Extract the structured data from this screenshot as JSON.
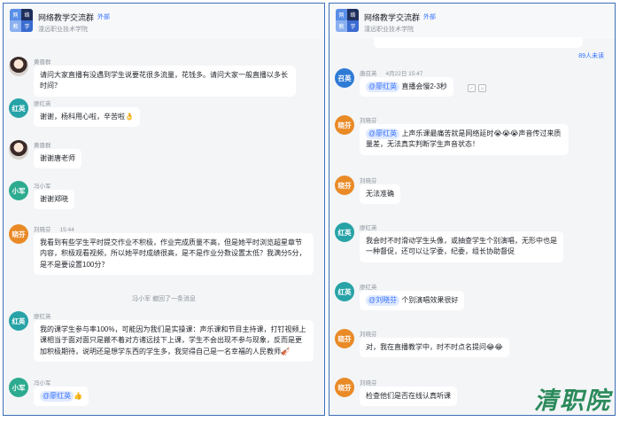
{
  "group": {
    "name": "网络教学交流群",
    "tag": "外部",
    "org": "潼远职业技术学院",
    "avatar_glyphs": [
      "网",
      "络",
      "教",
      "学"
    ]
  },
  "left_messages": [
    {
      "sender": "黄晋群",
      "time": "",
      "avatar": "",
      "lines": [
        "请问大家直播有没遇到学生说要花很多流量，花钱多。请问大家一般直播以多长时间？"
      ]
    },
    {
      "sender": "廖红英",
      "time": "",
      "avatar": "红英",
      "lines": [
        "谢谢，杨科用心啦，辛苦啦"
      ],
      "emoji": "👌"
    },
    {
      "sender": "黄晋群",
      "time": "",
      "avatar": "",
      "lines": [
        "谢谢唐老师"
      ]
    },
    {
      "sender": "冯小军",
      "time": "",
      "avatar": "小军",
      "lines": [
        "谢谢郑晓"
      ]
    },
    {
      "sender": "刘晓芬",
      "time": "15:44",
      "avatar": "晓芬",
      "lines": [
        "我看到有些学生平时提交作业不积极，作业完成质量不高，但是她平时浏览超星章节内容，积极观看视频，所以她平时成绩很高，是不是作业分数设置太低？我满分5分，是不是要设置100分？"
      ]
    },
    {
      "sender": "廖红英",
      "time": "",
      "avatar": "红英",
      "lines": [
        "我的课学生参与率100%，可能因为我们是实操课：声乐课和节目主持课，打钉视频上课相当于面对面只是搬不着对方诸远技下上课，学生不会出现不参与现象，反而是更加积极期待，说明还是想学东西的学生多，我觉得自己是一名幸福的人民教师"
      ],
      "emoji": "🎻"
    },
    {
      "sender": "冯小军",
      "time": "",
      "avatar": "小军",
      "mention": "@廖红英",
      "emoji": "👍"
    }
  ],
  "system_notice": "冯小军 撤回了一条消息",
  "right_messages": [
    {
      "sender": "唐召英",
      "time": "4月22日 15:47",
      "avatar": "召英",
      "mention": "@廖红英",
      "text": "直播会慢2-3秒"
    },
    {
      "sender": "刘晓芬",
      "time": "",
      "avatar": "晓芬",
      "mention": "@廖红英",
      "text": "上声乐课最痛苦就是网络延时",
      "emoji": "😭😭😭",
      "text2": "声音传过来质量差，无法真实判断学生声音状态！"
    },
    {
      "sender": "刘晓芬",
      "time": "",
      "avatar": "晓芬",
      "text": "无法准确"
    },
    {
      "sender": "廖红英",
      "time": "",
      "avatar": "红英",
      "text": "我会时不时滑动学生头像，或抽查学生个别演唱，无形中也是一种督促，还可以让学委，纪委，组长协助督促"
    },
    {
      "sender": "廖红英",
      "time": "",
      "avatar": "红英",
      "mention": "@刘晓芬",
      "text": "个别演唱效果很好"
    },
    {
      "sender": "刘晓芬",
      "time": "",
      "avatar": "晓芬",
      "text": "对，我在直播教学中，时不时点名提问",
      "emoji": "😂😂"
    },
    {
      "sender": "刘晓芬",
      "time": "",
      "avatar": "晓芬",
      "text": "检查他们是否在线认真听课"
    }
  ],
  "unread_label": "89人未读",
  "watermark": "清职院",
  "icons": {
    "read_status": "read-status-icon",
    "emoji_reaction": "emoji-reaction-icon"
  },
  "colors": {
    "accent": "#3370ff",
    "frame": "#3d6fb6",
    "mention_bg": "#e1eaff"
  }
}
